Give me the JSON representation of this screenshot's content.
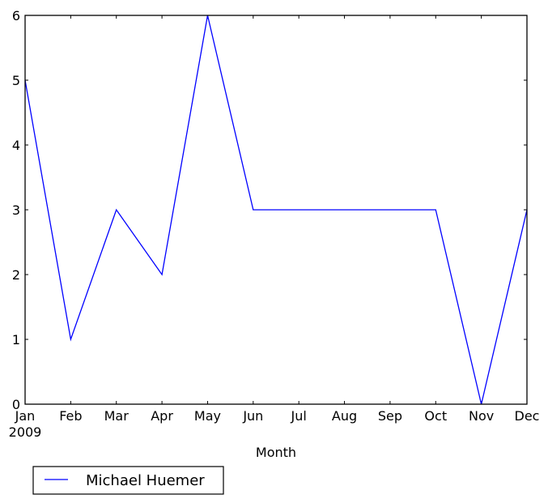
{
  "chart_data": {
    "type": "line",
    "title": "",
    "xlabel": "Month",
    "ylabel": "",
    "categories": [
      "Jan",
      "Feb",
      "Mar",
      "Apr",
      "May",
      "Jun",
      "Jul",
      "Aug",
      "Sep",
      "Oct",
      "Nov",
      "Dec"
    ],
    "x_sublabel": "2009",
    "yticks": [
      "0",
      "1",
      "2",
      "3",
      "4",
      "5",
      "6"
    ],
    "ylim": [
      0,
      6
    ],
    "grid": false,
    "legend_placement": "below-left",
    "series": [
      {
        "name": "Michael Huemer",
        "color": "#0000ff",
        "values": [
          5,
          1,
          3,
          2,
          6,
          3,
          3,
          3,
          3,
          3,
          0,
          3
        ]
      }
    ]
  }
}
